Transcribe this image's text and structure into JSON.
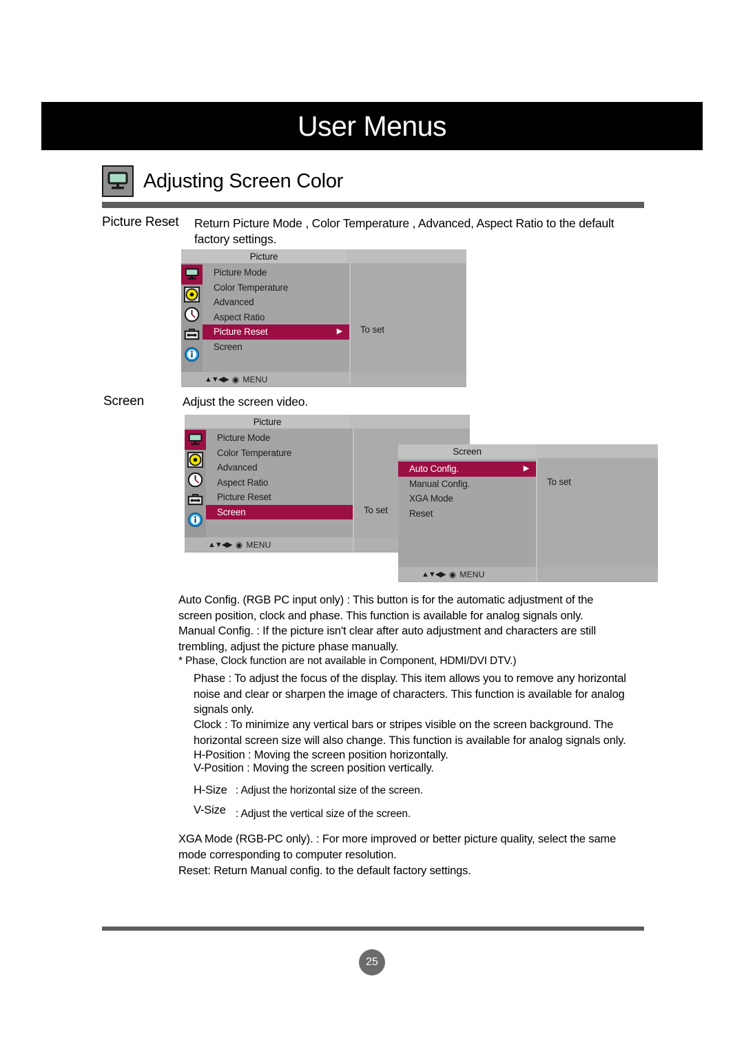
{
  "banner": {
    "title": "User Menus"
  },
  "section": {
    "icon": "monitor-icon",
    "title": "Adjusting Screen Color"
  },
  "picture_reset": {
    "label": "Picture Reset",
    "body": "Return Picture Mode , Color Temperature , Advanced, Aspect Ratio to the default factory settings."
  },
  "screen_entry": {
    "label": "Screen",
    "body": "Adjust the screen video."
  },
  "osd_menu_1": {
    "title": "Picture",
    "rail_icons": [
      "monitor-icon",
      "audio-icon",
      "clock-icon",
      "toolbox-icon",
      "info-icon"
    ],
    "selected_rail_index": 0,
    "items": [
      {
        "label": "Picture Mode",
        "highlighted": false,
        "arrow": ""
      },
      {
        "label": "Color Temperature",
        "highlighted": false,
        "arrow": ""
      },
      {
        "label": "Advanced",
        "highlighted": false,
        "arrow": ""
      },
      {
        "label": "Aspect Ratio",
        "highlighted": false,
        "arrow": ""
      },
      {
        "label": "Picture Reset",
        "highlighted": true,
        "arrow": "▶"
      },
      {
        "label": "Screen",
        "highlighted": false,
        "arrow": ""
      }
    ],
    "right_label": "To set",
    "footer": {
      "nav": "▲▼◀▶",
      "dot": "◉",
      "menu": "MENU"
    }
  },
  "osd_menu_2": {
    "title": "Picture",
    "rail_icons": [
      "monitor-icon",
      "audio-icon",
      "clock-icon",
      "toolbox-icon",
      "info-icon"
    ],
    "selected_rail_index": 0,
    "items": [
      {
        "label": "Picture Mode",
        "highlighted": false,
        "arrow": ""
      },
      {
        "label": "Color Temperature",
        "highlighted": false,
        "arrow": ""
      },
      {
        "label": "Advanced",
        "highlighted": false,
        "arrow": ""
      },
      {
        "label": "Aspect Ratio",
        "highlighted": false,
        "arrow": ""
      },
      {
        "label": "Picture Reset",
        "highlighted": false,
        "arrow": ""
      },
      {
        "label": "Screen",
        "highlighted": true,
        "arrow": ""
      }
    ],
    "right_label": "To set",
    "footer": {
      "nav": "▲▼◀▶",
      "dot": "◉",
      "menu": "MENU"
    }
  },
  "osd_submenu": {
    "title": "Screen",
    "items": [
      {
        "label": "Auto Config.",
        "highlighted": true,
        "arrow": "▶"
      },
      {
        "label": "Manual Config.",
        "highlighted": false,
        "arrow": ""
      },
      {
        "label": "XGA Mode",
        "highlighted": false,
        "arrow": ""
      },
      {
        "label": "Reset",
        "highlighted": false,
        "arrow": ""
      }
    ],
    "right_label": "To set",
    "footer": {
      "nav": "▲▼◀▶",
      "dot": "◉",
      "menu": "MENU"
    }
  },
  "descriptions": {
    "auto_config": "Auto Config.  (RGB PC input only) : This button is for the automatic adjustment of the screen position, clock and phase. This function is available for analog signals only.",
    "manual_config": "Manual Config. :   If the picture isn't clear after auto adjustment and characters are still trembling, adjust the picture phase manually.",
    "note": "* Phase, Clock function are not available in Component, HDMI/DVI DTV.)",
    "phase": "Phase :  To adjust the focus of the display. This item allows you to remove any horizontal noise and clear or sharpen the image of characters. This function is available for analog signals only.",
    "clock": "Clock :  To minimize any vertical bars or stripes visible on the screen background. The horizontal screen size will also change. This function is available for analog signals only.",
    "h_position": "H-Position :   Moving the screen position horizontally.",
    "v_position": "V-Position :   Moving the screen position vertically.",
    "h_size_label": "H-Size",
    "h_size_text": ": Adjust the horizontal size of the screen.",
    "v_size_label": "V-Size",
    "v_size_text": ": Adjust the vertical size of the screen.",
    "xga_mode": "XGA Mode (RGB-PC only). : For more improved or better picture quality, select the same mode corresponding to computer resolution.",
    "reset": "Reset: Return Manual config.  to the default factory settings."
  },
  "footer": {
    "page_number": "25"
  },
  "colors": {
    "accent_magenta": "#9b0f45",
    "banner_black": "#000000",
    "rule_gray": "#5d5d5d",
    "osd_body_gray": "#a5a5a5",
    "osd_title_gray": "#c2c2c2"
  }
}
